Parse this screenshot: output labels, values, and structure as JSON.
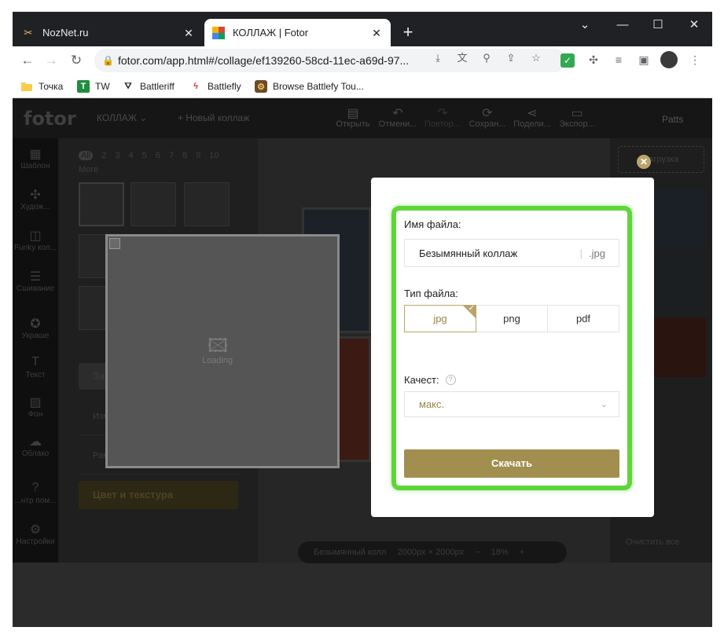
{
  "browser": {
    "tabs": [
      {
        "title": "NozNet.ru",
        "active": false,
        "favicon": "tools-icon"
      },
      {
        "title": "КОЛЛАЖ | Fotor",
        "active": true,
        "favicon": "fotor-icon"
      }
    ],
    "new_tab": "+",
    "url": "fotor.com/app.html#/collage/ef139260-58cd-11ec-a69d-97...",
    "bookmarks": [
      {
        "label": "Точка",
        "icon": "folder-icon"
      },
      {
        "label": "TW",
        "icon": "tw-icon"
      },
      {
        "label": "Battleriff",
        "icon": "battleriff-icon"
      },
      {
        "label": "Battlefly",
        "icon": "battlefly-icon"
      },
      {
        "label": "Browse Battlefy Tou...",
        "icon": "battlefy-icon"
      }
    ]
  },
  "app": {
    "logo": "fotor",
    "mode": "КОЛЛАЖ",
    "new_collage": "Новый коллаж",
    "toolbar": [
      "Открыть",
      "Отмени...",
      "Повтор...",
      "Сохран...",
      "Подели...",
      "Экспор..."
    ],
    "user": "Patts",
    "rail": [
      "Шаблон",
      "Худож...",
      "Funky кол...",
      "Сшивание",
      "Украше",
      "Текст",
      "Фон",
      "Облако",
      "...нтр пом...",
      "Настройки"
    ],
    "layout_counts": [
      "All",
      "2",
      "3",
      "4",
      "5",
      "6",
      "7",
      "8",
      "9",
      "10"
    ],
    "more": "More",
    "fill_label": "Заполнить",
    "resize_label": "Изменить размер",
    "frame_label": "Рамка",
    "texture_label": "Цвет и текстура",
    "loading": "Loading",
    "upload": "Загрузка",
    "clear_all": "Очистить все",
    "zoom": {
      "name": "Безымянный колл",
      "size": "2000px × 2000px",
      "minus": "−",
      "value": "18%",
      "plus": "+"
    }
  },
  "dialog": {
    "filename_label": "Имя файла:",
    "filename_value": "Безымянный коллаж",
    "filename_ext": ".jpg",
    "filetype_label": "Тип файла:",
    "filetypes": [
      "jpg",
      "png",
      "pdf"
    ],
    "selected_type": "jpg",
    "quality_label": "Качест:",
    "quality_value": "макс.",
    "download_label": "Скачать",
    "highlight_color": "#5ed63a",
    "accent_color": "#a28e4f"
  }
}
